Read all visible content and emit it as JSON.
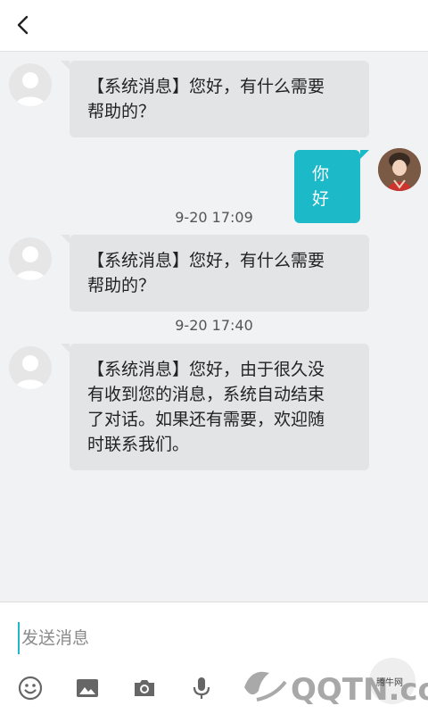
{
  "header": {
    "back_icon": "chevron-left-icon"
  },
  "messages": [
    {
      "side": "in",
      "text_line1": "【系统消息】您好，有什么需要",
      "text_line2": "帮助的？"
    },
    {
      "side": "out",
      "text": "你好"
    },
    {
      "timestamp": "9-20 17:09"
    },
    {
      "side": "in",
      "text_line1": "【系统消息】您好，有什么需要",
      "text_line2": "帮助的？"
    },
    {
      "timestamp": "9-20 17:40"
    },
    {
      "side": "in",
      "lines": [
        "【系统消息】您好，由于很久没",
        "有收到您的消息，系统自动结束",
        "了对话。如果还有需要，欢迎随",
        "时联系我们。"
      ]
    }
  ],
  "composer": {
    "placeholder": "发送消息",
    "tools": [
      "emoji-icon",
      "image-icon",
      "camera-icon",
      "microphone-icon"
    ]
  },
  "watermark": {
    "brand": "QQTN.com",
    "caption": "腾牛网"
  },
  "colors": {
    "accent": "#1cb9c9",
    "incoming_bubble": "#e3e4e6",
    "background": "#f1f2f4"
  }
}
